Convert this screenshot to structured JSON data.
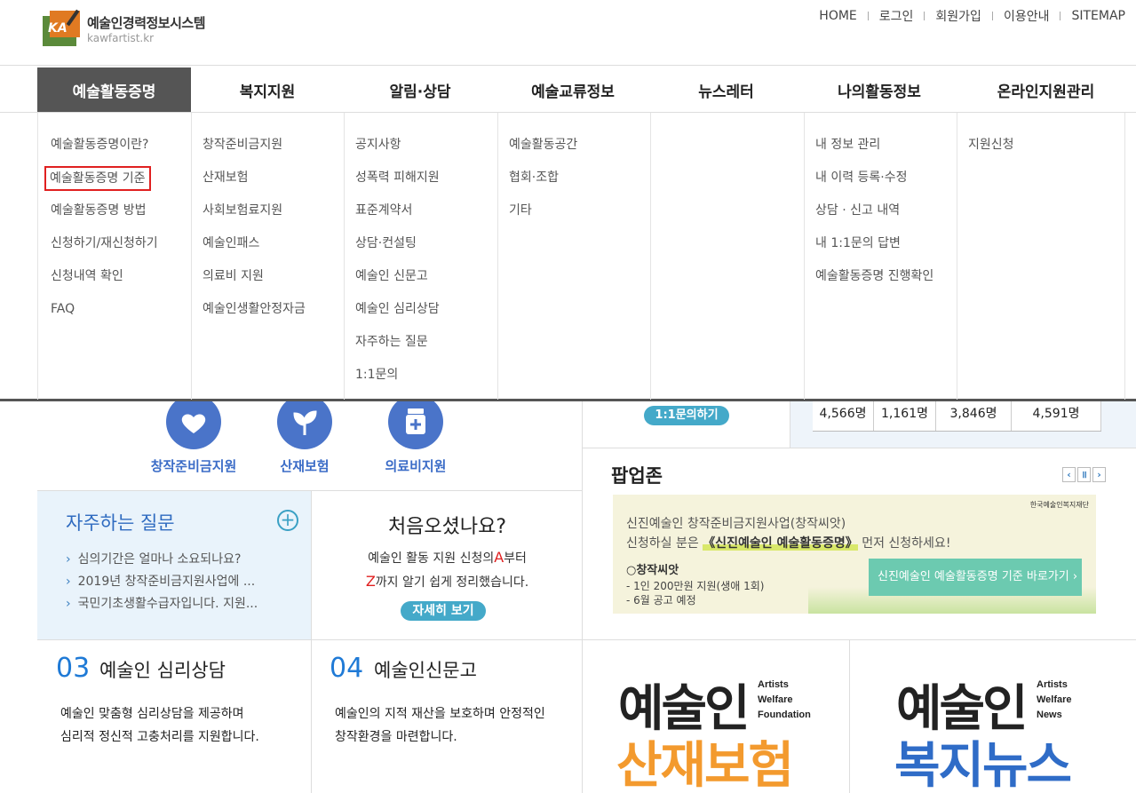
{
  "header": {
    "logo_title": "예술인경력정보시스템",
    "logo_url_text": "kawfartist.kr",
    "logo_mark_text": "KA",
    "util_links": [
      "HOME",
      "로그인",
      "회원가입",
      "이용안내",
      "SITEMAP"
    ]
  },
  "gnb": {
    "items": [
      "예술활동증명",
      "복지지원",
      "알림·상담",
      "예술교류정보",
      "뉴스레터",
      "나의활동정보",
      "온라인지원관리"
    ],
    "active_index": 0
  },
  "dropdown": {
    "columns": [
      [
        "예술활동증명이란?",
        "예술활동증명 기준",
        "예술활동증명 방법",
        "신청하기/재신청하기",
        "신청내역 확인",
        "FAQ"
      ],
      [
        "창작준비금지원",
        "산재보험",
        "사회보험료지원",
        "예술인패스",
        "의료비 지원",
        "예술인생활안정자금"
      ],
      [
        "공지사항",
        "성폭력 피해지원",
        "표준계약서",
        "상담·컨설팅",
        "예술인 신문고",
        "예술인 심리상담",
        "자주하는 질문",
        "1:1문의"
      ],
      [
        "예술활동공간",
        "협회·조합",
        "기타"
      ],
      [],
      [
        "내 정보 관리",
        "내 이력 등록·수정",
        "상담 · 신고 내역",
        "내 1:1문의 답변",
        "예술활동증명 진행확인"
      ],
      [
        "지원신청"
      ]
    ],
    "selected": "예술활동증명 기준"
  },
  "quick_icons": [
    {
      "label": "창작준비금지원",
      "icon": "heart-icon"
    },
    {
      "label": "산재보험",
      "icon": "leaf-icon"
    },
    {
      "label": "의료비지원",
      "icon": "medicine-icon"
    }
  ],
  "qna_button": "1:1문의하기",
  "stats": [
    "4,566명",
    "1,161명",
    "3,846명",
    "4,591명"
  ],
  "faq": {
    "title": "자주하는 질문",
    "items": [
      "심의기간은 얼마나 소요되나요?",
      "2019년 창작준비금지원사업에 ...",
      "국민기초생활수급자입니다. 지원..."
    ]
  },
  "first_visit": {
    "title": "처음오셨나요?",
    "line1_pre": "예술인 활동 지원 신청의",
    "line1_a": "A",
    "line1_post": "부터",
    "line2_z": "Z",
    "line2_post": "까지 알기 쉽게 정리했습니다.",
    "button": "자세히 보기"
  },
  "popup": {
    "title": "팝업존",
    "org": "한국예술인복지재단",
    "line1": "신진예술인 창작준비금지원사업(창작씨앗)",
    "line2_pre": "신청하실 분은",
    "line2_bold": "《신진예술인 예술활동증명》",
    "line2_post": "먼저 신청하세요!",
    "line3": "○창작씨앗",
    "line4": "- 1인 200만원 지원(생애 1회)",
    "line5": "- 6월 공고 예정",
    "button": "신진예술인 예술활동증명 기준 바로가기 ›"
  },
  "cards": [
    {
      "num": "03",
      "title": "예술인 심리상담",
      "desc1": "예술인 맞춤형 심리상담을 제공하며",
      "desc2": "심리적 정신적 고충처리를 지원합니다."
    },
    {
      "num": "04",
      "title": "예술인신문고",
      "desc1": "예술인의 지적 재산을 보호하며 안정적인",
      "desc2": "창작환경을 마련합니다."
    }
  ],
  "banners": [
    {
      "main": "예술인",
      "sub1": "Artists",
      "sub2": "Welfare",
      "sub3": "Foundation",
      "colored": "산재보험",
      "color": "#f39a2e"
    },
    {
      "main": "예술인",
      "sub1": "Artists",
      "sub2": "Welfare",
      "sub3": "News",
      "colored": "복지뉴스",
      "color": "#2f6cc7"
    }
  ]
}
